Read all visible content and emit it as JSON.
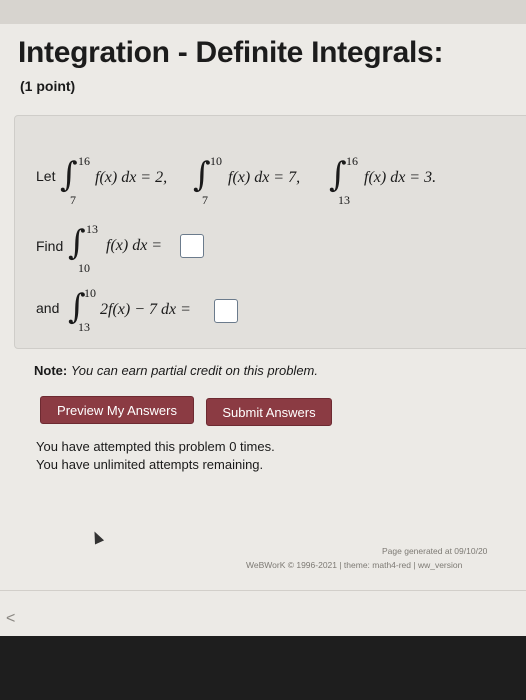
{
  "page": {
    "title": "Integration - Definite Integrals:",
    "points": "(1 point)"
  },
  "problem": {
    "let_label": "Let",
    "given": [
      {
        "upper": "16",
        "lower": "7",
        "expr": "f(x) dx = 2,"
      },
      {
        "upper": "10",
        "lower": "7",
        "expr": "f(x) dx = 7,"
      },
      {
        "upper": "16",
        "lower": "13",
        "expr": "f(x) dx = 3."
      }
    ],
    "find_label": "Find",
    "find": {
      "upper": "13",
      "lower": "10",
      "expr": "f(x) dx ="
    },
    "and_label": "and",
    "and": {
      "upper": "10",
      "lower": "13",
      "expr": "2f(x) − 7 dx ="
    }
  },
  "note": {
    "bold": "Note:",
    "text": "You can earn partial credit on this problem."
  },
  "buttons": {
    "preview": "Preview My Answers",
    "submit": "Submit Answers"
  },
  "attempts": {
    "line1": "You have attempted this problem 0 times.",
    "line2": "You have unlimited attempts remaining."
  },
  "footer": {
    "generated": "Page generated at 09/10/20",
    "copyright": "WeBWorK © 1996-2021 | theme: math4-red | ww_version"
  },
  "icons": {
    "back": "chevron-left-icon",
    "cursor": "mouse-cursor-icon"
  },
  "colors": {
    "button_bg": "#8b3b43",
    "button_text": "#ffffff"
  }
}
